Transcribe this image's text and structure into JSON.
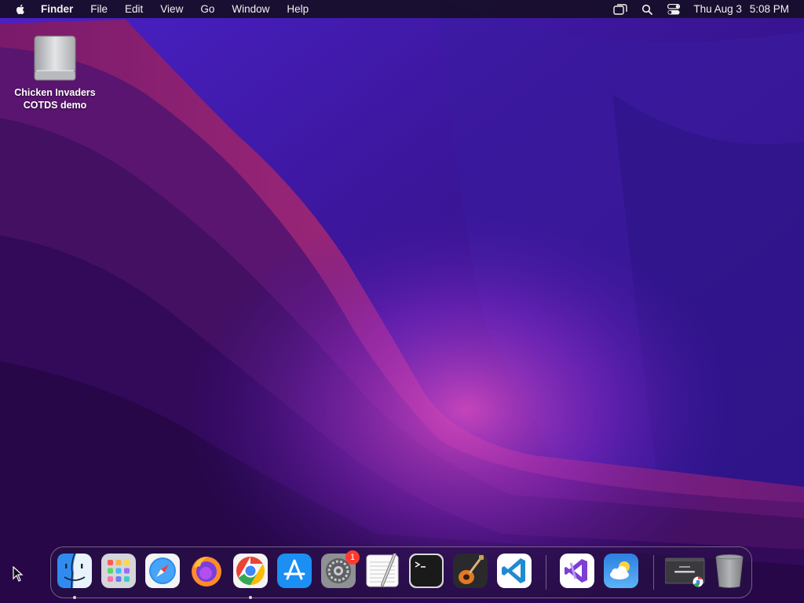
{
  "menubar": {
    "apple_icon": "apple-logo-icon",
    "app_name": "Finder",
    "menus": [
      "File",
      "Edit",
      "View",
      "Go",
      "Window",
      "Help"
    ],
    "status_icons": [
      "screen-mirroring-icon",
      "spotlight-search-icon",
      "control-center-icon"
    ],
    "date": "Thu Aug 3",
    "time": "5:08 PM"
  },
  "desktop": {
    "disk_icon": {
      "icon": "external-disk-icon",
      "label_line1": "Chicken Invaders",
      "label_line2": "COTDS demo"
    }
  },
  "dock": {
    "apps": [
      {
        "name": "Finder",
        "icon": "finder-icon",
        "running": true
      },
      {
        "name": "Launchpad",
        "icon": "launchpad-icon",
        "running": false
      },
      {
        "name": "Safari",
        "icon": "safari-icon",
        "running": false
      },
      {
        "name": "Firefox",
        "icon": "firefox-icon",
        "running": false
      },
      {
        "name": "Google Chrome",
        "icon": "chrome-icon",
        "running": true
      },
      {
        "name": "App Store",
        "icon": "app-store-icon",
        "running": false
      },
      {
        "name": "System Settings",
        "icon": "system-settings-icon",
        "running": false,
        "badge": "1"
      },
      {
        "name": "TextEdit",
        "icon": "textedit-icon",
        "running": false
      },
      {
        "name": "Terminal",
        "icon": "terminal-icon",
        "running": false
      },
      {
        "name": "GarageBand",
        "icon": "garageband-icon",
        "running": false
      },
      {
        "name": "Visual Studio Code",
        "icon": "vscode-icon",
        "running": false
      },
      {
        "name": "Visual Studio",
        "icon": "visual-studio-icon",
        "running": false
      },
      {
        "name": "Weather",
        "icon": "weather-icon",
        "running": false
      },
      {
        "name": "Chrome window",
        "icon": "chrome-window-thumbnail-icon",
        "running": false
      },
      {
        "name": "Trash",
        "icon": "trash-icon",
        "running": false
      }
    ]
  },
  "colors": {
    "menubar_bg": "#160e26",
    "badge": "#ff3b30",
    "wallpaper_dark": "#2a0a63",
    "wallpaper_accent": "#c0308a"
  }
}
